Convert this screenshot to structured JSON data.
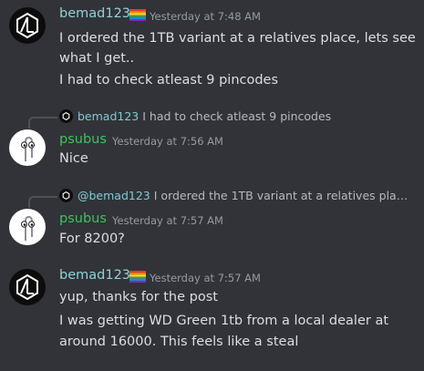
{
  "colors": {
    "bemad": "#8fd1d9",
    "psubus": "#3ec25f",
    "mention": "#7ecbd3",
    "background": "#313338"
  },
  "messages": [
    {
      "author": "bemad123",
      "has_flag": true,
      "timestamp": "Yesterday at 7:48 AM",
      "lines": [
        "I ordered the 1TB variant at a relatives place, lets see",
        "what I get..",
        "I had to check atleast 9 pincodes"
      ]
    },
    {
      "reply": {
        "name": "bemad123",
        "text": "I had to check atleast 9 pincodes"
      },
      "author": "psubus",
      "timestamp": "Yesterday at 7:56 AM",
      "lines": [
        "Nice"
      ]
    },
    {
      "reply": {
        "name": "@bemad123",
        "text": "I ordered the 1TB variant at a relatives place, l..."
      },
      "author": "psubus",
      "timestamp": "Yesterday at 7:57 AM",
      "lines": [
        "For 8200?"
      ]
    },
    {
      "author": "bemad123",
      "has_flag": true,
      "timestamp": "Yesterday at 7:57 AM",
      "lines": [
        "yup, thanks for the post",
        "I was getting WD Green 1tb from a local dealer at",
        "around 16000. This feels like a steal"
      ]
    }
  ]
}
